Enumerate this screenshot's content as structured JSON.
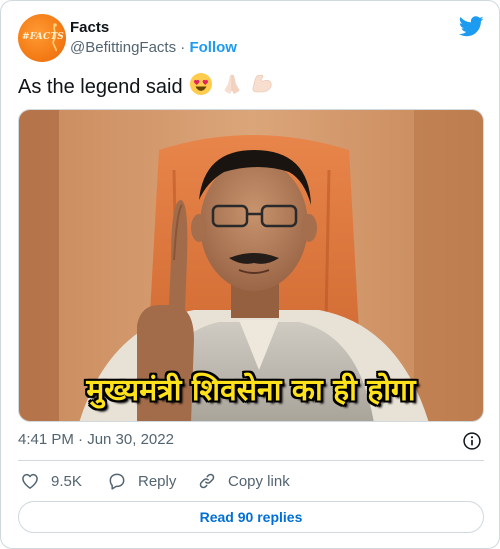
{
  "account": {
    "display_name": "Facts",
    "handle": "@BefittingFacts",
    "separator": "·",
    "follow_label": "Follow",
    "avatar_text": "#FACTS"
  },
  "tweet": {
    "text": "As the legend said",
    "emojis": [
      "smiling-face-with-heart-eyes",
      "folded-hands",
      "flexed-biceps"
    ],
    "media_caption": "मुख्यमंत्री शिवसेना का ही होगा",
    "timestamp": "4:41 PM · Jun 30, 2022"
  },
  "actions": {
    "like_count": "9.5K",
    "reply_label": "Reply",
    "copy_label": "Copy link"
  },
  "read_replies_label": "Read 90 replies",
  "colors": {
    "accent": "#1d9bf0",
    "link_button": "#006fd6",
    "secondary_text": "#536471",
    "border": "#cfd9de",
    "caption_yellow": "#ffe21a"
  }
}
